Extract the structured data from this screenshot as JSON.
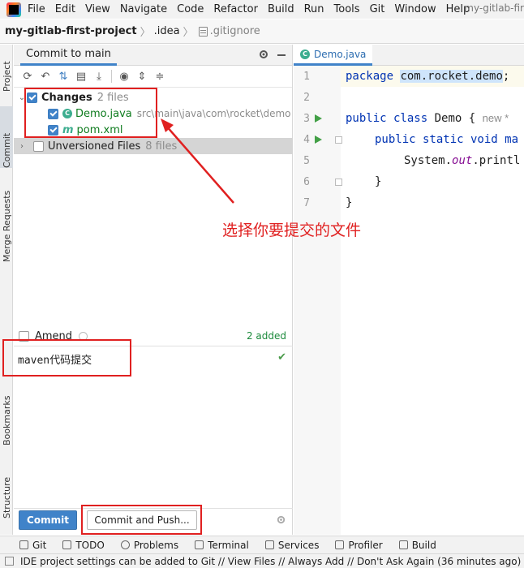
{
  "menu": {
    "items": [
      "File",
      "Edit",
      "View",
      "Navigate",
      "Code",
      "Refactor",
      "Build",
      "Run",
      "Tools",
      "Git",
      "Window",
      "Help"
    ],
    "window_title": "my-gitlab-fir"
  },
  "breadcrumb": {
    "project": "my-gitlab-first-project",
    "folder": ".idea",
    "file": ".gitignore"
  },
  "left_stripe": {
    "project": "Project",
    "commit": "Commit",
    "merge_requests": "Merge Requests",
    "bookmarks": "Bookmarks",
    "structure": "Structure"
  },
  "commit_panel": {
    "tab": "Commit to main",
    "changes": {
      "label": "Changes",
      "count": "2 files"
    },
    "files": [
      {
        "name": "Demo.java",
        "path": "src\\main\\java\\com\\rocket\\demo",
        "icon": "java-class-icon"
      },
      {
        "name": "pom.xml",
        "path": "",
        "icon": "maven-icon"
      }
    ],
    "unversioned": {
      "label": "Unversioned Files",
      "count": "8 files"
    },
    "amend": "Amend",
    "added": "2 added",
    "message": "maven代码提交",
    "commit_button": "Commit",
    "commit_push_button": "Commit and Push..."
  },
  "editor": {
    "tab": "Demo.java",
    "line_numbers": [
      "1",
      "2",
      "3",
      "4",
      "5",
      "6",
      "7"
    ],
    "lines": {
      "l1_kw": "package",
      "l1_pkg": "com.rocket.demo",
      "l1_end": ";",
      "l3_kw": "public class",
      "l3_name": " Demo {",
      "l3_hint": "new *",
      "l4_kw": "public static void",
      "l4_name": " ma",
      "l5_a": "System.",
      "l5_b": "out",
      "l5_c": ".printl",
      "l6": "}",
      "l7": "}"
    }
  },
  "annotation": "选择你要提交的文件",
  "tool_stripe": [
    "Git",
    "TODO",
    "Problems",
    "Terminal",
    "Services",
    "Profiler",
    "Build"
  ],
  "status": "IDE project settings can be added to Git // View Files // Always Add // Don't Ask Again (36 minutes ago)",
  "colors": {
    "accent": "#4083c9",
    "annotation": "#e02020"
  }
}
